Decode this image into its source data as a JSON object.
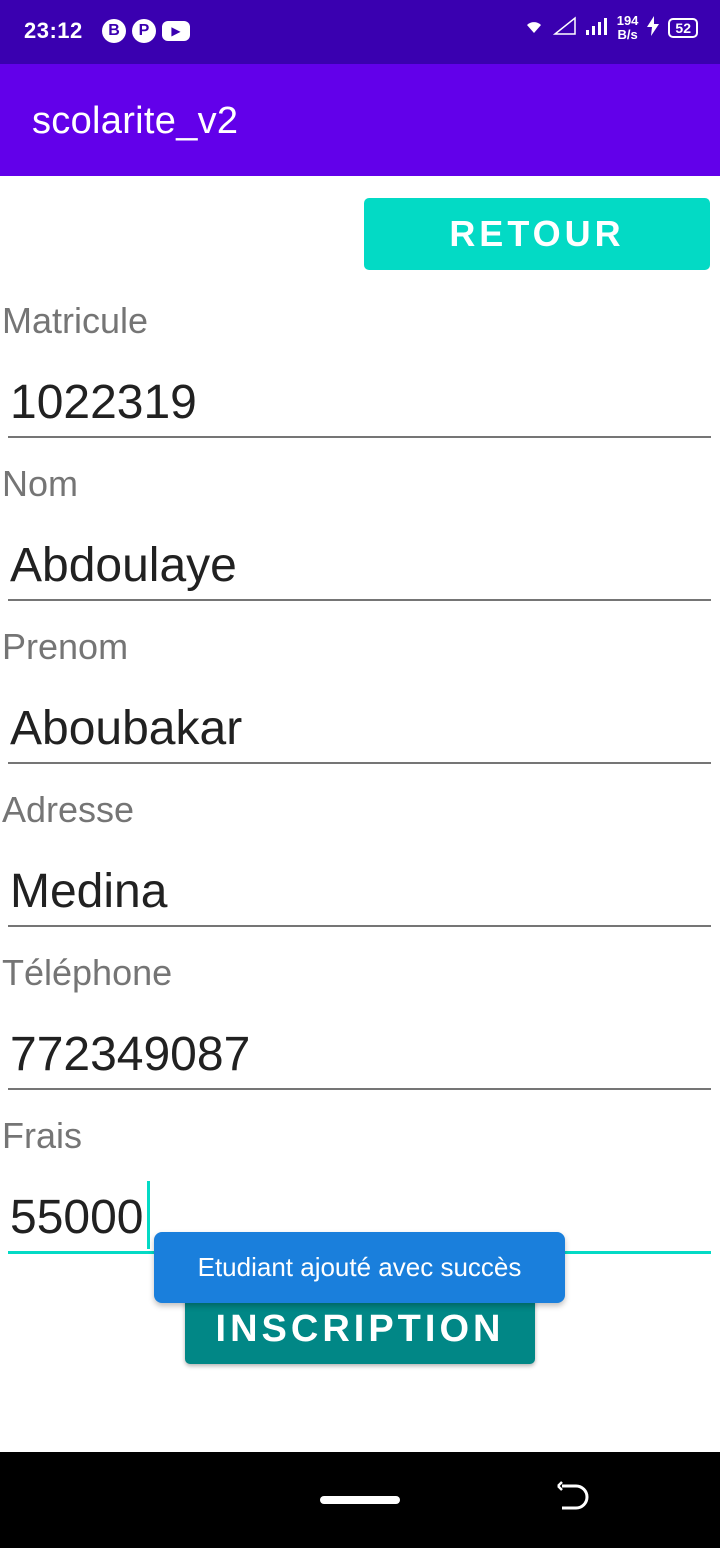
{
  "status_bar": {
    "time": "23:12",
    "notif_icons": [
      "B",
      "P",
      "▶"
    ],
    "net_speed_value": "194",
    "net_speed_unit": "B/s",
    "battery": "52"
  },
  "app_bar": {
    "title": "scolarite_v2"
  },
  "buttons": {
    "retour": "RETOUR",
    "inscription": "INSCRIPTION"
  },
  "form": {
    "matricule": {
      "label": "Matricule",
      "value": "1022319"
    },
    "nom": {
      "label": "Nom",
      "value": "Abdoulaye"
    },
    "prenom": {
      "label": "Prenom",
      "value": "Aboubakar"
    },
    "adresse": {
      "label": "Adresse",
      "value": "Medina"
    },
    "telephone": {
      "label": "Téléphone",
      "value": "772349087"
    },
    "frais": {
      "label": "Frais",
      "value": "55000"
    }
  },
  "toast": {
    "message": "Etudiant ajouté avec succès"
  },
  "colors": {
    "status_bar": "#3a00b0",
    "app_bar": "#6200ea",
    "accent": "#03dac5",
    "inscription": "#018786",
    "toast": "#1a7fdc"
  }
}
